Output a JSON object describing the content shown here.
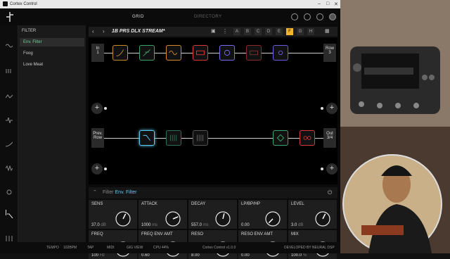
{
  "window": {
    "title": "Cortex Control"
  },
  "topbar": {
    "grid_tab": "GRID",
    "directory_tab": "DIRECTORY"
  },
  "sidebar": {
    "header": "FILTER",
    "items": [
      {
        "label": "Env. Filter",
        "selected": true
      },
      {
        "label": "Foog",
        "selected": false
      },
      {
        "label": "Love Meat",
        "selected": false
      }
    ]
  },
  "preset": {
    "name": "1B PRS DLX STREAM*",
    "slots": [
      "A",
      "B",
      "C",
      "D",
      "E",
      "F",
      "G",
      "H"
    ],
    "active_slot": "F"
  },
  "grid": {
    "row1": {
      "in_label": "In",
      "in_num": "1",
      "out_label": "Row",
      "out_num": "3"
    },
    "row2": {
      "in_label1": "Prev.",
      "in_label2": "Row",
      "out_label": "Out",
      "out_num": "3/4"
    },
    "add_symbol": "+"
  },
  "fx": {
    "prefix": "Filter",
    "name": "Env. Filter"
  },
  "params": [
    {
      "label": "SENS",
      "value": "37.0",
      "unit": "dB",
      "level": 0.6
    },
    {
      "label": "ATTACK",
      "value": "1000",
      "unit": "ms",
      "level": 0.75
    },
    {
      "label": "DECAY",
      "value": "557.0",
      "unit": "ms",
      "level": 0.55
    },
    {
      "label": "LP/BP/HP",
      "value": "0.00",
      "unit": "",
      "level": 0.0
    },
    {
      "label": "LEVEL",
      "value": "3.0",
      "unit": "dB",
      "level": 0.6
    },
    {
      "label": "FREQ",
      "value": "100",
      "unit": "Hz",
      "level": 0.15
    },
    {
      "label": "FREQ ENV AMT",
      "value": "0.60",
      "unit": "",
      "level": 0.8
    },
    {
      "label": "RESO",
      "value": "8.00",
      "unit": "",
      "level": 0.7
    },
    {
      "label": "RESO ENV AMT",
      "value": "0.00",
      "unit": "",
      "level": 0.7
    },
    {
      "label": "MIX",
      "value": "100.0",
      "unit": "%",
      "level": 1.0
    }
  ],
  "status": {
    "tempo": "TEMPO",
    "bpm": "102BPM",
    "tap": "TAP",
    "midi": "MIDI",
    "gig": "GIG VIEW",
    "cpu": "CPU 44%",
    "version": "Cortex Control v1.0.0",
    "dev": "DEVELOPED BY NEURAL DSP"
  },
  "colors": {
    "accent": "#5cc8f0",
    "active_slot": "#f2b52c",
    "sel_text": "#6fcf97"
  }
}
